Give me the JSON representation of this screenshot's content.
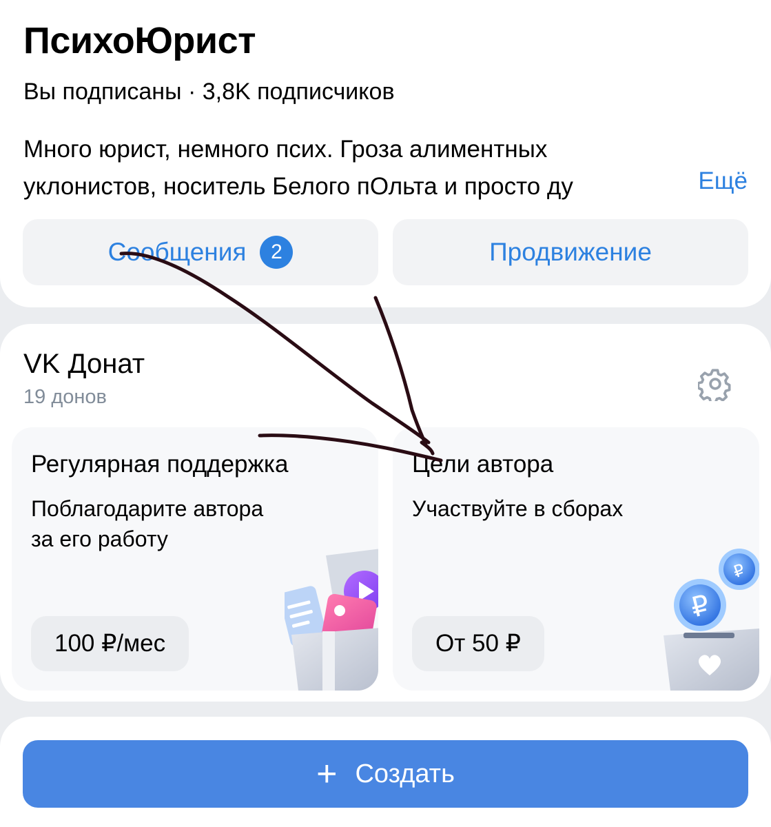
{
  "profile": {
    "title": "ПсихоЮрист",
    "subscribed": "Вы подписаны",
    "separator": "·",
    "subscribers": "3,8K",
    "subscribers_suffix": "подписчиков",
    "description_line1": "Много юрист, немного псих. Гроза алиментных",
    "description_line2": "уклонистов, носитель Белого пОльта и просто ду",
    "more": "Ещё",
    "messages_label": "Сообщения",
    "messages_count": "2",
    "promo_label": "Продвижение"
  },
  "donut": {
    "title": "VK Донат",
    "count": "19 донов",
    "settings_icon": "gear-icon",
    "tiles": [
      {
        "title": "Регулярная поддержка",
        "text_line1": "Поблагодарите автора",
        "text_line2": "за его работу",
        "price": "100 ₽/мес"
      },
      {
        "title": "Цели автора",
        "text_line1": "Участвуйте в сборах",
        "text_line2": "",
        "price": "От 50 ₽"
      }
    ]
  },
  "create": {
    "label": "Создать",
    "icon": "plus-icon"
  },
  "colors": {
    "accent": "#2d81e0",
    "create_button": "#4986e2",
    "background": "#ebedf0",
    "secondary_text": "#818c99",
    "annotation_ink": "#2a0c14"
  }
}
